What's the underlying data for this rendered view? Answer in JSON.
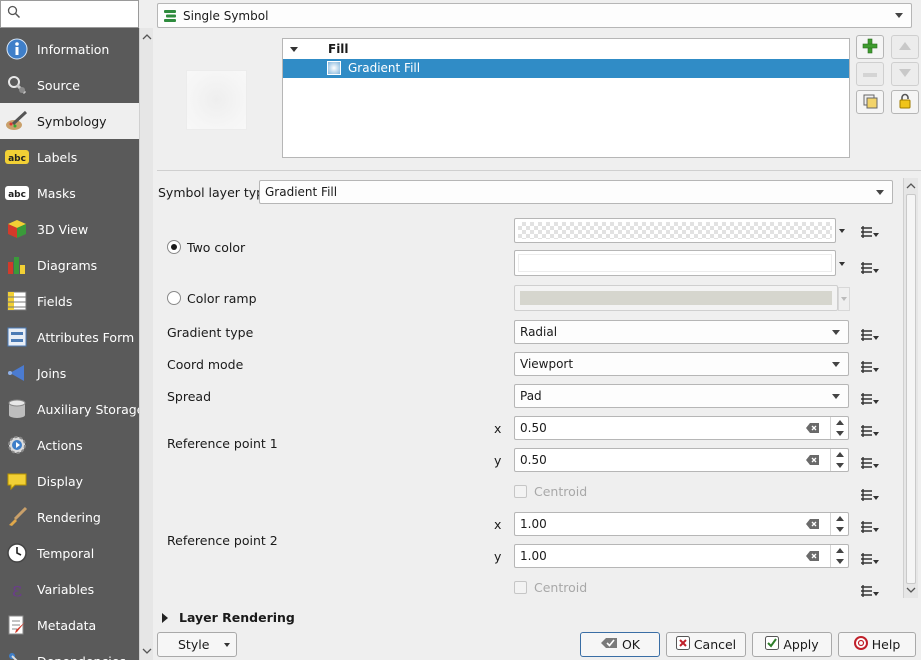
{
  "sidebar": {
    "search": {
      "value": "",
      "icon": "search-icon"
    },
    "items": [
      {
        "label": "Information",
        "icon": "info-icon",
        "active": false
      },
      {
        "label": "Source",
        "icon": "source-wrench-icon",
        "active": false
      },
      {
        "label": "Symbology",
        "icon": "brush-palette-icon",
        "active": true
      },
      {
        "label": "Labels",
        "icon": "abc-label-icon",
        "active": false
      },
      {
        "label": "Masks",
        "icon": "abc-mask-icon",
        "active": false
      },
      {
        "label": "3D View",
        "icon": "cube-3d-icon",
        "active": false
      },
      {
        "label": "Diagrams",
        "icon": "diagram-icon",
        "active": false
      },
      {
        "label": "Fields",
        "icon": "fields-table-icon",
        "active": false
      },
      {
        "label": "Attributes Form",
        "icon": "form-icon",
        "active": false
      },
      {
        "label": "Joins",
        "icon": "join-icon",
        "active": false
      },
      {
        "label": "Auxiliary Storage",
        "icon": "database-icon",
        "active": false
      },
      {
        "label": "Actions",
        "icon": "gear-play-icon",
        "active": false
      },
      {
        "label": "Display",
        "icon": "speech-bubble-icon",
        "active": false
      },
      {
        "label": "Rendering",
        "icon": "paintbrush-icon",
        "active": false
      },
      {
        "label": "Temporal",
        "icon": "clock-icon",
        "active": false
      },
      {
        "label": "Variables",
        "icon": "epsilon-icon",
        "active": false
      },
      {
        "label": "Metadata",
        "icon": "metadata-edit-icon",
        "active": false
      },
      {
        "label": "Dependencies",
        "icon": "dependencies-icon",
        "active": false
      }
    ]
  },
  "renderer": {
    "label": "Single Symbol",
    "icon": "single-symbol-icon"
  },
  "tree": {
    "root_label": "Fill",
    "child_label": "Gradient Fill",
    "side_buttons": [
      "add-layer",
      "remove-layer",
      "move-up",
      "move-down",
      "duplicate-layer",
      "lock-layer"
    ]
  },
  "layer_type": {
    "label": "Symbol layer type",
    "value": "Gradient Fill"
  },
  "gradient": {
    "two_color_label": "Two color",
    "color_ramp_label": "Color ramp",
    "two_color_selected": true,
    "color1": "transparent",
    "color2": "#ffffff",
    "ramp_color": "#d6d6ce",
    "gradient_type": {
      "label": "Gradient type",
      "value": "Radial"
    },
    "coord_mode": {
      "label": "Coord mode",
      "value": "Viewport"
    },
    "spread": {
      "label": "Spread",
      "value": "Pad"
    },
    "ref1": {
      "label": "Reference point 1",
      "x_label": "x",
      "y_label": "y",
      "x": "0.50",
      "y": "0.50",
      "centroid_label": "Centroid"
    },
    "ref2": {
      "label": "Reference point 2",
      "x_label": "x",
      "y_label": "y",
      "x": "1.00",
      "y": "1.00",
      "centroid_label": "Centroid"
    }
  },
  "layer_rendering": {
    "label": "Layer Rendering"
  },
  "footer": {
    "style": "Style",
    "ok": "OK",
    "cancel": "Cancel",
    "apply": "Apply",
    "help": "Help"
  },
  "colors": {
    "selection": "#308cc6",
    "sidebar_bg": "#5a5a5a"
  }
}
